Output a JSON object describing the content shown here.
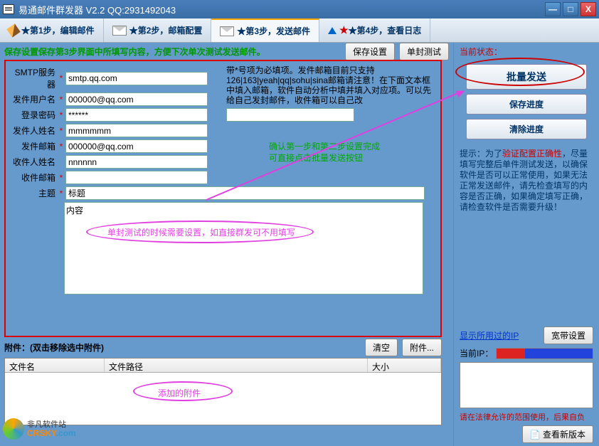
{
  "window": {
    "title": "易通邮件群发器  V2.2    QQ:2931492043",
    "min": "—",
    "max": "□",
    "close": "X"
  },
  "tabs": {
    "t1": "★第1步，编辑邮件",
    "t2": "★第2步，邮箱配置",
    "t3": "★第3步，发送邮件",
    "t4": "★第4步，查看日志"
  },
  "topHint": "保存设置保存第3步界面中所填写内容，方便下次单次测试发送邮件。",
  "buttons": {
    "saveCfg": "保存设置",
    "singleTest": "单封测试",
    "clear": "清空",
    "attach": "附件..."
  },
  "form": {
    "smtp": {
      "label": "SMTP服务器",
      "value": "smtp.qq.com"
    },
    "user": {
      "label": "发件用户名",
      "value": "000000@qq.com"
    },
    "pass": {
      "label": "登录密码",
      "value": "******"
    },
    "sname": {
      "label": "发件人姓名",
      "value": "mmmmmm"
    },
    "smail": {
      "label": "发件邮箱",
      "value": "000000@qq.com"
    },
    "rname": {
      "label": "收件人姓名",
      "value": "nnnnnn"
    },
    "rmail": {
      "label": "收件邮箱",
      "value": ""
    },
    "subject": {
      "label": "主题",
      "value": "标题"
    },
    "content": {
      "label": "内容",
      "value": "内容"
    }
  },
  "smtpNote": "带*号项为必填项。发件邮箱目前只支持126|163|yeah|qq|sohu|sina邮箱请注意！在下面文本框中填入邮箱，软件自动分析中填并填入对应项。可以先给自己发封邮件，收件箱可以自己改",
  "greenNote1": "确认第一步和第二步设置完成",
  "greenNote2": "可直接点击批量发送按钮",
  "annot": {
    "test": "单封测试的时候需要设置，如直接群发可不用填写",
    "attach": "添加的附件"
  },
  "attach": {
    "title": "附件：(双击移除选中附件)",
    "colName": "文件名",
    "colPath": "文件路径",
    "colSize": "大小"
  },
  "sidebar": {
    "status": "当前状态：",
    "batchSend": "批量发送",
    "saveProg": "保存进度",
    "clearProg": "清除进度",
    "tip_pre": "提示：为了",
    "tip_kw": "验证配置正确性",
    "tip_post": "，尽量填写完整后单件测试发送，以确保软件是否可以正常使用，如果无法正常发送邮件，请先检查填写的内容是否正确，如果确定填写正确，请检查软件是否需要升级！",
    "showIP": "显示所用过的IP",
    "bwSet": "宽带设置",
    "curIP": "当前IP：",
    "legal": "请在法律允许的范围使用，后果自负",
    "checkNew": "查看新版本"
  },
  "logo": {
    "cn": "非凡软件站",
    "en1": "CRSKY",
    "en2": ".com"
  }
}
